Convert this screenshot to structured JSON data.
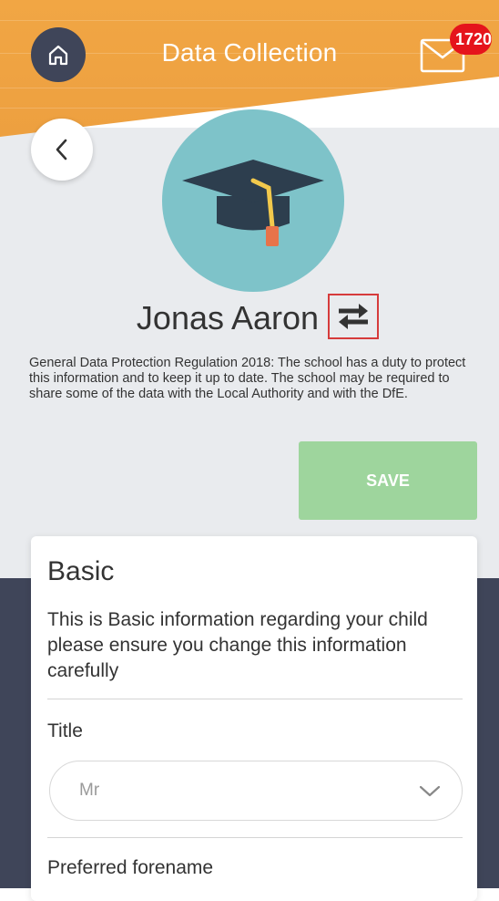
{
  "header": {
    "title": "Data Collection",
    "mail_badge": "1720"
  },
  "profile": {
    "name": "Jonas Aaron",
    "gdpr_text": "General Data Protection Regulation 2018: The school has a duty to protect this information and to keep it up to date. The school may be required to share some of the data with the Local Authority and with the DfE.",
    "save_label": "SAVE"
  },
  "card": {
    "title": "Basic",
    "description": "This is Basic information regarding your child please ensure you change this information carefully",
    "fields": [
      {
        "label": "Title",
        "value": "Mr"
      },
      {
        "label": "Preferred forename"
      }
    ]
  },
  "colors": {
    "header": "#f1a644",
    "navy": "#3f4559",
    "save": "#9ed59d",
    "badge": "#e5141c",
    "avatar_bg": "#7ec3c9"
  },
  "icons": [
    "home-icon",
    "mail-icon",
    "chevron-left-icon",
    "graduation-cap-icon",
    "swap-arrows-icon",
    "chevron-down-icon"
  ]
}
